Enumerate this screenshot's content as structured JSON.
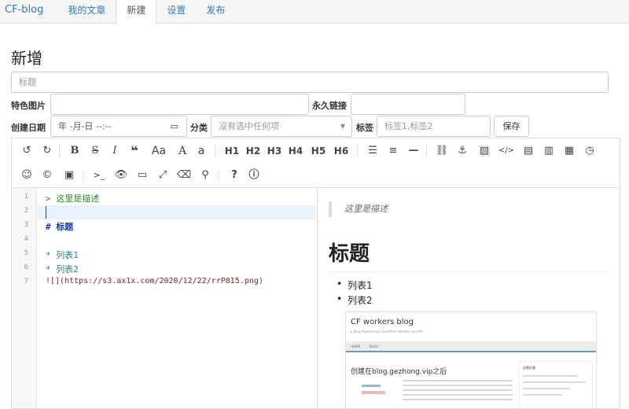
{
  "nav": {
    "brand": "CF-blog",
    "items": [
      "我的文章",
      "新建",
      "设置",
      "发布"
    ]
  },
  "page_title": "新增",
  "form": {
    "title_placeholder": "标题",
    "featured_image_label": "特色图片",
    "permalink_label": "永久链接",
    "created_date_label": "创建日期",
    "date_value": "年 -月-日 --:--",
    "category_label": "分类",
    "category_placeholder": "没有选中任何项",
    "tags_label": "标签",
    "tags_placeholder": "标签1,标签2",
    "save_label": "保存"
  },
  "toolbar": {
    "heading_labels": [
      "H1",
      "H2",
      "H3",
      "H4",
      "H5",
      "H6"
    ],
    "case_label": "Aa",
    "upper_a": "A",
    "lower_a": "a"
  },
  "editor": {
    "line_numbers": [
      "1",
      "2",
      "3",
      "4",
      "5",
      "6",
      "7"
    ],
    "lines": [
      "> 这里是描述",
      "",
      "# 标题",
      "",
      "* 列表1",
      "* 列表2",
      "![](https://s3.ax1x.com/2020/12/22/rrP815.png)"
    ]
  },
  "preview": {
    "quote": "这里是描述",
    "heading": "标题",
    "list": [
      "列表1",
      "列表2"
    ],
    "image": {
      "title": "CF workers blog",
      "subtitle": "a Blog Powered by Cloudflare Workers and KV",
      "tabs": [
        "HOME",
        "BLOG"
      ],
      "post_title": "创建在blog.gezhong.vip之后",
      "sidebar_title": "近期文章"
    }
  },
  "colors": {
    "link": "#337ab7",
    "code_green": "#2e8b2e",
    "code_blue": "#1a3cb0",
    "code_teal": "#2a7f8f",
    "code_red": "#8a2020"
  }
}
